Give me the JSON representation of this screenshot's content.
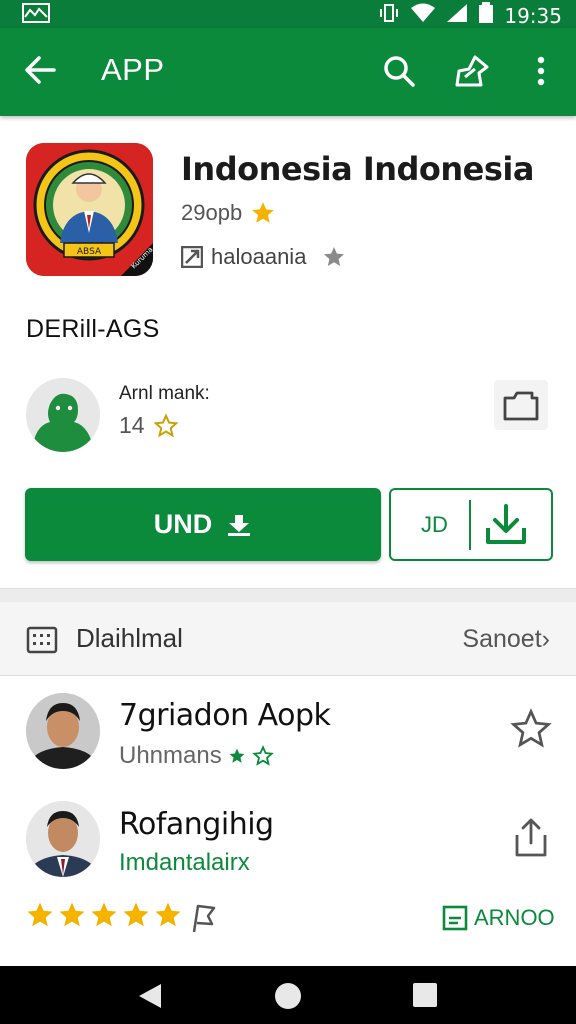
{
  "status_bar": {
    "time": "19:35"
  },
  "app_bar": {
    "title": "APP"
  },
  "app_info": {
    "name": "Indonesia Indonesia",
    "rating_text": "29opb",
    "developer": "haloaania",
    "icon_badge": "ABSA",
    "icon_corner_text": "Kuruma"
  },
  "section_label": "DERill-AGS",
  "author": {
    "name": "Arnl mank:",
    "score": "14"
  },
  "buttons": {
    "primary_label": "UND",
    "secondary_label": "JD"
  },
  "section_header": {
    "label": "Dlaihlmal",
    "more_label": "Sanoet",
    "more_chevron": "›"
  },
  "list": [
    {
      "name": "7griadon Aopk",
      "subtitle": "Uhnmans",
      "subtitle_color": "#666666"
    },
    {
      "name": "Rofangihig",
      "subtitle": "Imdantalairx",
      "subtitle_color": "#0c8a3c"
    }
  ],
  "footer_row": {
    "stars": 5,
    "archive_label": "ARNOO"
  },
  "colors": {
    "brand_green": "#0c8a3c",
    "status_green": "#0a7d3a",
    "star_gold": "#f5b301"
  },
  "icons": {
    "back": "arrow-left-icon",
    "search": "search-icon",
    "share": "share-icon",
    "more": "more-vert-icon"
  }
}
